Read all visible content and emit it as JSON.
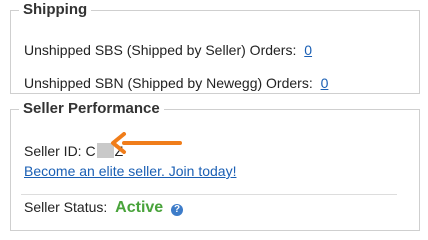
{
  "shipping": {
    "title": "Shipping",
    "sbs_label": "Unshipped SBS (Shipped by Seller) Orders:",
    "sbs_count": "0",
    "sbn_label": "Unshipped SBN (Shipped by Newegg) Orders:",
    "sbn_count": "0"
  },
  "performance": {
    "title": "Seller Performance",
    "seller_id_label": "Seller ID:",
    "seller_id_prefix": "C",
    "seller_id_suffix": "Z",
    "elite_link": "Become an elite seller. Join today!",
    "status_label": "Seller Status:",
    "status_value": "Active"
  },
  "colors": {
    "arrow": "#f07d1a",
    "active": "#49a33b",
    "link": "#1a5fb4"
  },
  "icons": {
    "help": "question-circle-icon",
    "annotation": "arrow-left-icon"
  }
}
